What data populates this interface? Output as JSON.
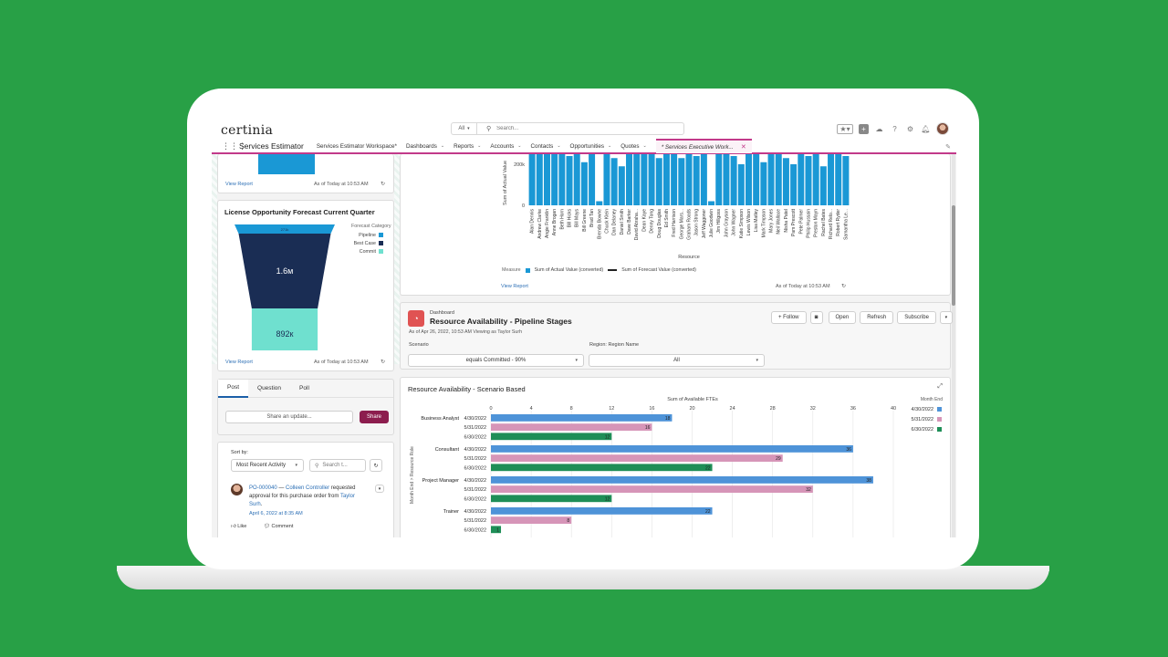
{
  "app": {
    "logo": "certinia",
    "name": "Services Estimator",
    "search_scope": "All",
    "search_placeholder": "Search...",
    "nav": [
      {
        "label": "Services Estimator Workspace*",
        "chevron": false
      },
      {
        "label": "Dashboards",
        "chevron": true
      },
      {
        "label": "Reports",
        "chevron": true
      },
      {
        "label": "Accounts",
        "chevron": true
      },
      {
        "label": "Contacts",
        "chevron": true
      },
      {
        "label": "Opportunities",
        "chevron": true
      },
      {
        "label": "Quotes",
        "chevron": true
      }
    ],
    "active_tab": "* Services Executive Work...",
    "icons": [
      "star-icon",
      "add-icon",
      "assistant-icon",
      "help-icon",
      "gear-icon",
      "bell-icon"
    ]
  },
  "left": {
    "top_card": {
      "view_report": "View Report",
      "asof": "As of Today at 10:53 AM"
    },
    "funnel_card": {
      "title": "License Opportunity Forecast Current Quarter",
      "legend_title": "Forecast Category",
      "legend": [
        {
          "label": "Pipeline",
          "color": "#1a98d5"
        },
        {
          "label": "Best Case",
          "color": "#1a2d54"
        },
        {
          "label": "Commit",
          "color": "#6fe0cf"
        }
      ],
      "segments": [
        {
          "label": "271k",
          "value": 0.271,
          "color": "#1a98d5"
        },
        {
          "label": "1.6м",
          "value": 1.6,
          "color": "#1a2d54"
        },
        {
          "label": "892к",
          "value": 0.892,
          "color": "#6fe0cf"
        }
      ],
      "view_report": "View Report",
      "asof": "As of Today at 10:53 AM"
    },
    "feed": {
      "tabs": [
        "Post",
        "Question",
        "Poll"
      ],
      "share_placeholder": "Share an update...",
      "share_button": "Share",
      "sort_label": "Sort by:",
      "sort_value": "Most Recent Activity",
      "search_placeholder": "Search t...",
      "post": {
        "record": "PO-000040",
        "dash": " — ",
        "author": "Colleen Controller",
        "text": " requested approval for this purchase order from ",
        "target": "Taylor Surh",
        "end": ".",
        "date": "April 6, 2022 at 8:35 AM"
      },
      "like": "Like",
      "comment": "Comment"
    }
  },
  "right": {
    "top_chart": {
      "ylabel": "Sum of Actual Value",
      "yticks": [
        "200k",
        "0"
      ],
      "xlabel": "Resource",
      "measure_label": "Measure",
      "measure_actual": "Sum of Actual Value (converted)",
      "measure_forecast": "Sum of Forecast Value (converted)",
      "view_report": "View Report",
      "asof": "As of Today at 10:53 AM",
      "bar_color": "#1a98d5",
      "names": [
        "Alan Dennis",
        "Andrew Clarke",
        "Angie Franklin",
        "Anne Brogan",
        "Beth Horn",
        "Bill Hicks",
        "Bill Mays",
        "Bill Greene",
        "Brad Tan",
        "Brenda Bowne",
        "Chuck Klein",
        "Dan Delaney",
        "Daniel Smith",
        "Dave Barker",
        "David Abraha...",
        "Dean Kaye",
        "Denny Tong",
        "Doug Douglas",
        "Ed Smith",
        "Fred Harrison",
        "George Mars...",
        "Graham Roads",
        "Jason Strong",
        "Jeff Waggoner",
        "Julie Goodwin",
        "Jim Hillgoss",
        "John Grayson",
        "John Wagner",
        "Katie Simpson",
        "Lewis Wilson",
        "Lisa Matley",
        "Mark Timpson",
        "Mary Jones",
        "Neil Wallace",
        "Nisha Patel",
        "Pam Prescott",
        "Pete Palmer",
        "Philip Hussain",
        "Preston Mayn",
        "Rachel Bates",
        "Richard Relo...",
        "Robert Ryder",
        "Samantha Le..."
      ],
      "values": [
        260,
        290,
        250,
        270,
        300,
        240,
        290,
        210,
        280,
        20,
        280,
        230,
        190,
        250,
        250,
        250,
        250,
        230,
        250,
        260,
        230,
        320,
        240,
        250,
        20,
        270,
        250,
        240,
        200,
        250,
        250,
        210,
        290,
        250,
        230,
        200,
        320,
        240,
        280,
        190,
        250,
        250,
        240
      ]
    },
    "dashboard": {
      "kind": "Dashboard",
      "title": "Resource Availability - Pipeline Stages",
      "asof": "As of Apr 26, 2022, 10:53 AM Viewing as Taylor Surh",
      "buttons": [
        "+ Follow",
        "Open",
        "Refresh",
        "Subscribe"
      ],
      "scenario_label": "Scenario",
      "scenario_value": "equals Committed - 90%",
      "region_label": "Region: Region Name",
      "region_value": "All"
    },
    "bar_chart": {
      "title": "Resource Availability - Scenario Based",
      "xlabel": "Sum of Available FTEs",
      "ylabel": "Month End > Resource Role",
      "legend_title": "Month End"
    }
  },
  "chart_data": [
    {
      "type": "bar",
      "title": "Resource Availability - Scenario Based",
      "xlabel": "Sum of Available FTEs",
      "ylabel": "Month End > Resource Role",
      "orientation": "horizontal",
      "xlim": [
        0,
        40
      ],
      "xticks": [
        0,
        4,
        8,
        12,
        16,
        20,
        24,
        28,
        32,
        36,
        40
      ],
      "legend_position": "top-right",
      "groups": [
        {
          "name": "Business Analyst",
          "rows": [
            {
              "date": "4/30/2022",
              "value": 18
            },
            {
              "date": "5/31/2022",
              "value": 16
            },
            {
              "date": "6/30/2022",
              "value": 12
            }
          ]
        },
        {
          "name": "Consultant",
          "rows": [
            {
              "date": "4/30/2022",
              "value": 36
            },
            {
              "date": "5/31/2022",
              "value": 29
            },
            {
              "date": "6/30/2022",
              "value": 22
            }
          ]
        },
        {
          "name": "Project Manager",
          "rows": [
            {
              "date": "4/30/2022",
              "value": 38
            },
            {
              "date": "5/31/2022",
              "value": 32
            },
            {
              "date": "6/30/2022",
              "value": 12
            }
          ]
        },
        {
          "name": "Trainer",
          "rows": [
            {
              "date": "4/30/2022",
              "value": 22
            },
            {
              "date": "5/31/2022",
              "value": 8
            },
            {
              "date": "6/30/2022",
              "value": 1
            }
          ]
        }
      ],
      "series": [
        {
          "name": "4/30/2022",
          "color": "#4e93d8"
        },
        {
          "name": "5/31/2022",
          "color": "#d695b8"
        },
        {
          "name": "6/30/2022",
          "color": "#1e8e57"
        }
      ]
    }
  ]
}
